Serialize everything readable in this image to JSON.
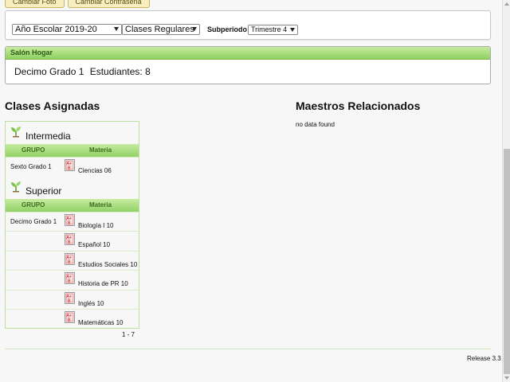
{
  "top_buttons": {
    "change_photo": "Cambiar Foto",
    "change_password": "Cambiar Contraseña"
  },
  "filters": {
    "school_year": "Año Escolar 2019-20",
    "class_type": "Clases Regulares",
    "subperiod_label": "Subperiodo",
    "subperiod": "Trimestre 4"
  },
  "homeroom": {
    "header": "Salón Hogar",
    "grade": "Decimo Grado 1",
    "students": "Estudiantes: 8"
  },
  "assigned_classes": {
    "title": "Clases Asignadas",
    "levels": [
      {
        "name": "Intermedia",
        "col_group": "GRUPO",
        "col_subject": "Materia",
        "rows": [
          {
            "group": "Sexto Grado 1",
            "subject": "Ciencias 06"
          }
        ]
      },
      {
        "name": "Superior",
        "col_group": "GRUPO",
        "col_subject": "Materia",
        "rows": [
          {
            "group": "Decimo Grado 1",
            "subject": "Biología I 10"
          },
          {
            "group": "",
            "subject": "Español 10"
          },
          {
            "group": "",
            "subject": "Estudios Sociales 10"
          },
          {
            "group": "",
            "subject": "Historia de PR 10"
          },
          {
            "group": "",
            "subject": "Inglés 10"
          },
          {
            "group": "",
            "subject": "Matemáticas 10"
          }
        ]
      }
    ],
    "pager": "1 - 7"
  },
  "related_teachers": {
    "title": "Maestros Relacionados",
    "empty_text": "no data found"
  },
  "footer": {
    "release": "Release 3.3"
  },
  "colors": {
    "accent_green": "#8fd060",
    "button_yellow": "#f8efc0"
  }
}
